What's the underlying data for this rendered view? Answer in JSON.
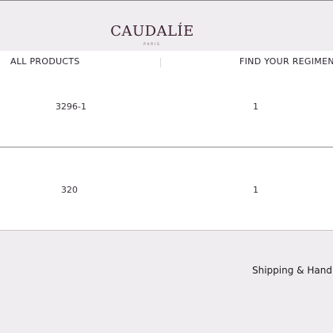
{
  "brand": {
    "name": "CAUDALÍE",
    "tagline": "PARIS"
  },
  "nav": {
    "items": [
      {
        "label": "ALL PRODUCTS"
      },
      {
        "label": "FIND YOUR REGIMEN"
      }
    ]
  },
  "table": {
    "rows": [
      {
        "code": "3296-1",
        "qty": "1"
      },
      {
        "code": "320",
        "qty": "1"
      }
    ]
  },
  "footer": {
    "shipping_label": "Shipping & Handling"
  },
  "colors": {
    "background": "#efedef",
    "brand": "#3d2230",
    "text": "#1e1a1e"
  }
}
